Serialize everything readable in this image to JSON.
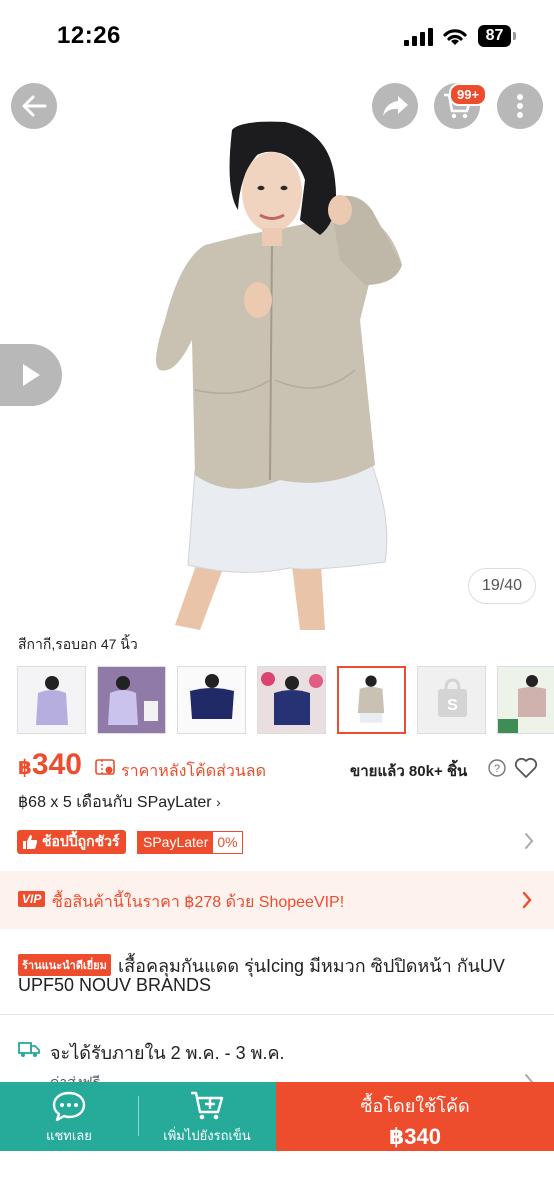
{
  "status": {
    "time": "12:26",
    "battery": "87"
  },
  "header": {
    "cart_badge": "99+"
  },
  "gallery": {
    "counter": "19/40"
  },
  "variant": {
    "selected_label": "สีกากี,รอบอก 47 นิ้ว",
    "thumb_count": 7
  },
  "price": {
    "currency": "฿",
    "value": "340",
    "note": "ราคาหลังโค้ดส่วนลด",
    "sold": "ขายแล้ว 80k+ ชิ้น",
    "installment": "฿68 x 5 เดือนกับ SPayLater"
  },
  "badges": {
    "mall": "ช้อปปี้ถูกชัวร์",
    "spay_label": "SPayLater",
    "spay_rate": "0%"
  },
  "vip": {
    "tag": "VIP",
    "text": "ซื้อสินค้านี้ในราคา ฿278 ด้วย ShopeeVIP!"
  },
  "product": {
    "tag": "ร้านแนะนำดีเยี่ยม",
    "title_line1": "เสื้อคลุมกันแดด รุ่นIcing มีหมวก ซิปปิดหน้า กันUV",
    "title_line2": "UPF50 NOUV BRANDS"
  },
  "shipping": {
    "text": "จะได้รับภายใน 2 พ.ค. - 3 พ.ค.",
    "sub": "ค่าส่งฟรี"
  },
  "bottom_bar": {
    "chat_label": "แชทเลย",
    "add_cart_label": "เพิ่มไปยังรถเข็น",
    "buy_label": "ซื้อโดยใช้โค้ด",
    "buy_price": "฿340"
  },
  "colors": {
    "accent": "#ee4d2d",
    "teal": "#26aa99"
  }
}
